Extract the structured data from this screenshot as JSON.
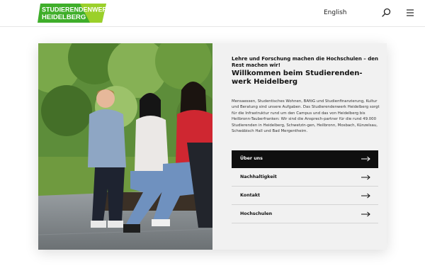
{
  "header": {
    "logo_line1": "STUDIERENDENWERK",
    "logo_line2": "HEIDELBERG",
    "language": "English",
    "icons": {
      "search": "search-icon",
      "menu": "menu-icon"
    },
    "colors": {
      "brand_green": "#3fae2a",
      "brand_light_green": "#9bd02a"
    }
  },
  "hero": {
    "photo_alt": "group-of-students-sitting-on-bench",
    "eyebrow": "Lehre und Forschung machen die Hochschulen – den Rest machen wir!",
    "title": "Willkommen beim Studierenden-werk Heidelberg",
    "description": "Mensaessen, Studentisches Wohnen, BAföG und Studienfinanzierung, Kultur und Beratung sind unsere Aufgaben. Das Studierendenwerk Heidelberg sorgt für die Infrastruktur rund um den Campus und das von Heidelberg bis Heilbronn-Tauberfranken: Wir sind die Ansprech-partner für die rund 49.000 Studierenden in Heidelberg, Schwetzin-gen, Heilbronn, Mosbach, Künzelsau, Schwäbisch Hall und Bad Mergentheim.",
    "nav": [
      {
        "label": "Über uns",
        "active": true
      },
      {
        "label": "Nachhaltigkeit",
        "active": false
      },
      {
        "label": "Kontakt",
        "active": false
      },
      {
        "label": "Hochschulen",
        "active": false
      }
    ]
  }
}
